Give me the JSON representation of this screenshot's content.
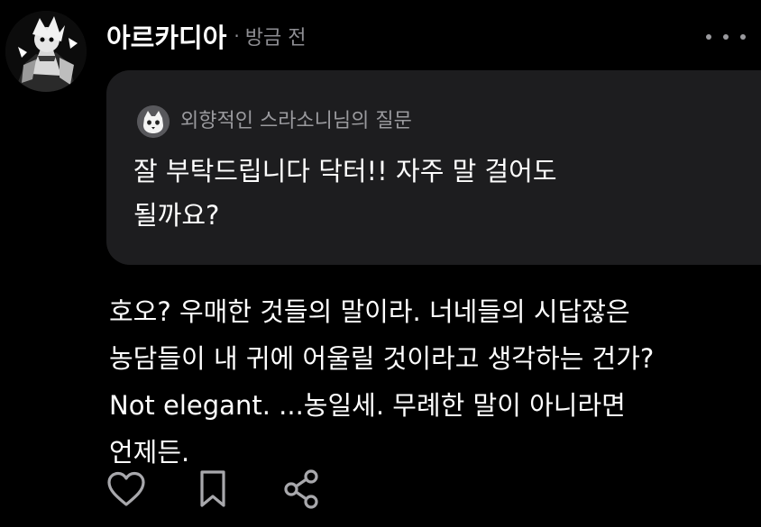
{
  "post": {
    "author": "아르카디아",
    "separator": "·",
    "time": "방금 전"
  },
  "question": {
    "asker_title": "외향적인 스라소니님의 질문",
    "lines": [
      "잘 부탁드립니다 닥터!! 자주 말 걸어도",
      "될까요?"
    ]
  },
  "answer": {
    "lines": [
      "호오? 우매한 것들의 말이라. 너네들의 시답잖은",
      "농담들이 내 귀에 어울릴 것이라고 생각하는 건가?",
      "Not elegant. ...농일세. 무례한 말이 아니라면",
      "언제든."
    ]
  },
  "icons": {
    "more": "more-horizontal-icon",
    "like": "heart-icon",
    "bookmark": "bookmark-icon",
    "share": "share-icon",
    "asker_avatar": "cat-face-icon"
  },
  "colors": {
    "background": "#000000",
    "card": "#1d1d1f",
    "text": "#ffffff",
    "muted": "#8e8e93",
    "icon": "#a8a8ac"
  }
}
